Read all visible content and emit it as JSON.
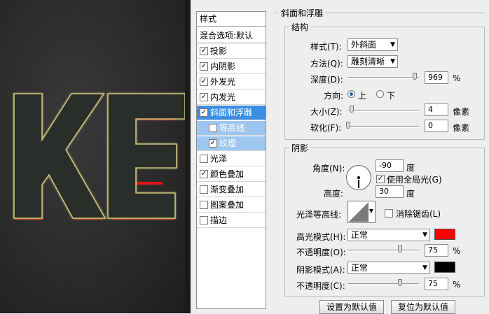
{
  "canvas": {
    "text": "KE",
    "text_fill": "#2b2d2a",
    "glow_color": "#c9c07a",
    "bevel_color": "#e01414"
  },
  "styles_list": {
    "header": "样式",
    "blend_options": "混合选项:默认",
    "items": [
      {
        "label": "投影",
        "checked": true
      },
      {
        "label": "内阴影",
        "checked": true
      },
      {
        "label": "外发光",
        "checked": true
      },
      {
        "label": "内发光",
        "checked": true
      },
      {
        "label": "斜面和浮雕",
        "checked": true,
        "selected": true
      },
      {
        "label": "等高线",
        "checked": false,
        "sub": true
      },
      {
        "label": "纹理",
        "checked": true,
        "sub": true
      },
      {
        "label": "光泽",
        "checked": false
      },
      {
        "label": "颜色叠加",
        "checked": true
      },
      {
        "label": "渐变叠加",
        "checked": false
      },
      {
        "label": "图案叠加",
        "checked": false
      },
      {
        "label": "描边",
        "checked": false
      }
    ]
  },
  "bevel": {
    "title": "斜面和浮雕",
    "structure": {
      "legend": "结构",
      "style_label": "样式(T):",
      "style_value": "外斜面",
      "technique_label": "方法(Q):",
      "technique_value": "雕刻清晰",
      "depth_label": "深度(D):",
      "depth_value": "969",
      "depth_unit": "%",
      "depth_fraction": 0.97,
      "direction_label": "方向:",
      "direction_up": "上",
      "direction_down": "下",
      "size_label": "大小(Z):",
      "size_value": "4",
      "size_unit": "像素",
      "soften_label": "软化(F):",
      "soften_value": "0",
      "soften_unit": "像素"
    },
    "shading": {
      "legend": "阴影",
      "angle_label": "角度(N):",
      "angle_value": "-90",
      "angle_unit": "度",
      "global_light_label": "使用全局光(G)",
      "altitude_label": "高度:",
      "altitude_value": "30",
      "altitude_unit": "度",
      "gloss_contour_label": "光泽等高线:",
      "anti_alias_label": "消除锯齿(L)",
      "highlight_mode_label": "高光模式(H):",
      "highlight_mode_value": "正常",
      "highlight_color": "#ff0000",
      "highlight_opacity_label": "不透明度(O):",
      "highlight_opacity_value": "75",
      "highlight_opacity_unit": "%",
      "shadow_mode_label": "阴影模式(A):",
      "shadow_mode_value": "正常",
      "shadow_color": "#000000",
      "shadow_opacity_label": "不透明度(C):",
      "shadow_opacity_value": "75",
      "shadow_opacity_unit": "%"
    }
  },
  "buttons": {
    "make_default": "设置为默认值",
    "reset_default": "复位为默认值"
  }
}
